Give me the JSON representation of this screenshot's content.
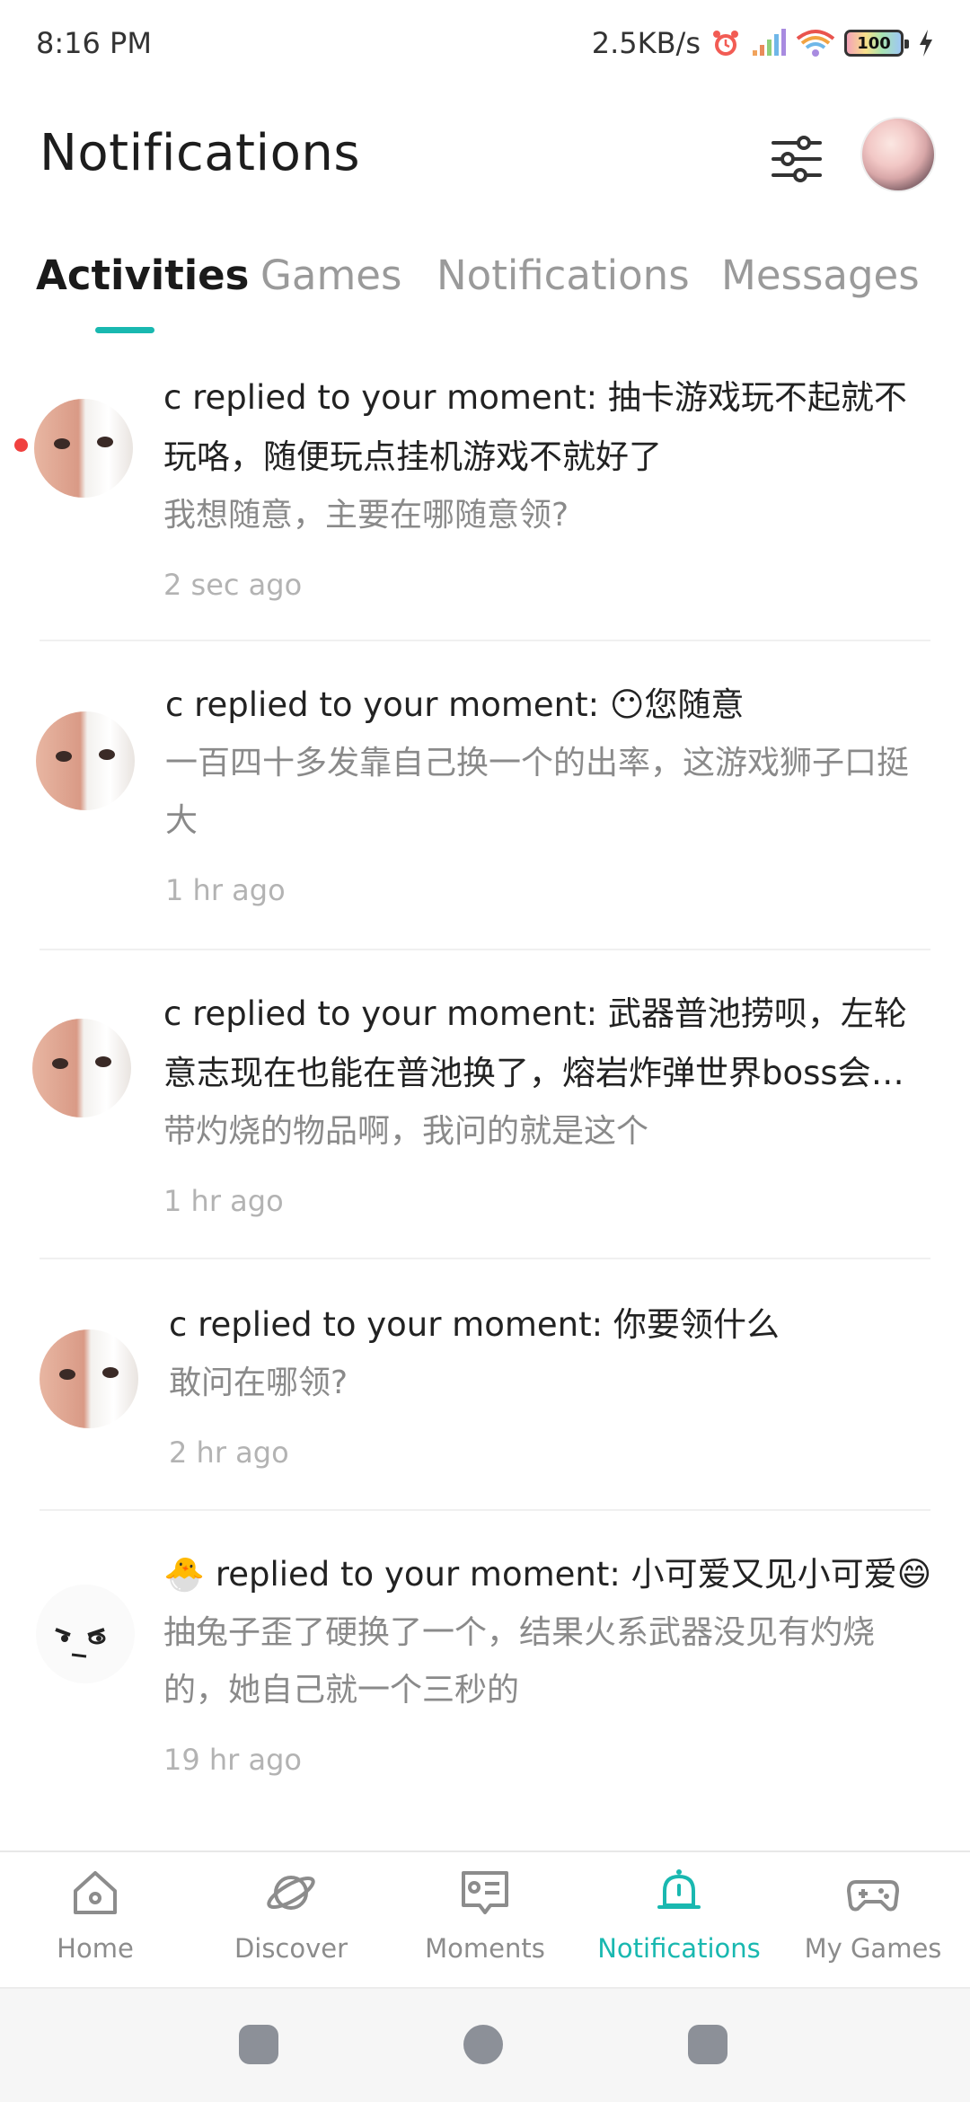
{
  "status_bar": {
    "time": "8:16 PM",
    "net_speed": "2.5KB/s",
    "battery_level": "100",
    "icons": [
      "alarm-icon",
      "signal-icon",
      "wifi-icon",
      "battery-icon",
      "charging-icon"
    ]
  },
  "header": {
    "title": "Notifications",
    "filter_icon": "sliders-icon"
  },
  "tabs": [
    {
      "label": "Activities",
      "active": true
    },
    {
      "label": "Games",
      "active": false
    },
    {
      "label": "Notifications",
      "active": false
    },
    {
      "label": "Messages",
      "active": false
    }
  ],
  "activities": [
    {
      "headline": "c replied to your moment: 抽卡游戏玩不起就不玩咯，随便玩点挂机游戏不就好了",
      "body": "我想随意，主要在哪随意领?",
      "time": "2 sec ago",
      "unread": true
    },
    {
      "headline": "c replied to your moment: 😶您随意",
      "body": "一百四十多发靠自己换一个的出率，这游戏狮子口挺大",
      "time": "1 hr ago",
      "unread": false
    },
    {
      "headline": "c replied to your moment: 武器普池捞呗，左轮意志现在也能在普池换了，熔岩炸弹世界boss会掉落，可以去刷刷",
      "body": "带灼烧的物品啊，我问的就是这个",
      "time": "1 hr ago",
      "unread": false
    },
    {
      "headline": "c replied to your moment: 你要领什么",
      "body": "敢问在哪领?",
      "time": "2 hr ago",
      "unread": false
    },
    {
      "headline": "🐣 replied to your moment: 小可爱又见小可爱😄",
      "body": "抽兔子歪了硬换了一个，结果火系武器没见有灼烧的，她自己就一个三秒的",
      "time": "19 hr ago",
      "unread": false
    }
  ],
  "bottom_nav": [
    {
      "label": "Home",
      "icon": "home-icon",
      "active": false
    },
    {
      "label": "Discover",
      "icon": "planet-icon",
      "active": false
    },
    {
      "label": "Moments",
      "icon": "moments-icon",
      "active": false
    },
    {
      "label": "Notifications",
      "icon": "bell-icon",
      "active": true
    },
    {
      "label": "My Games",
      "icon": "gamepad-icon",
      "active": false
    }
  ],
  "colors": {
    "accent": "#19b8b0",
    "unread_dot": "#f0413f",
    "secondary_text": "#8a8a8a",
    "time_text": "#b3b3b3"
  }
}
